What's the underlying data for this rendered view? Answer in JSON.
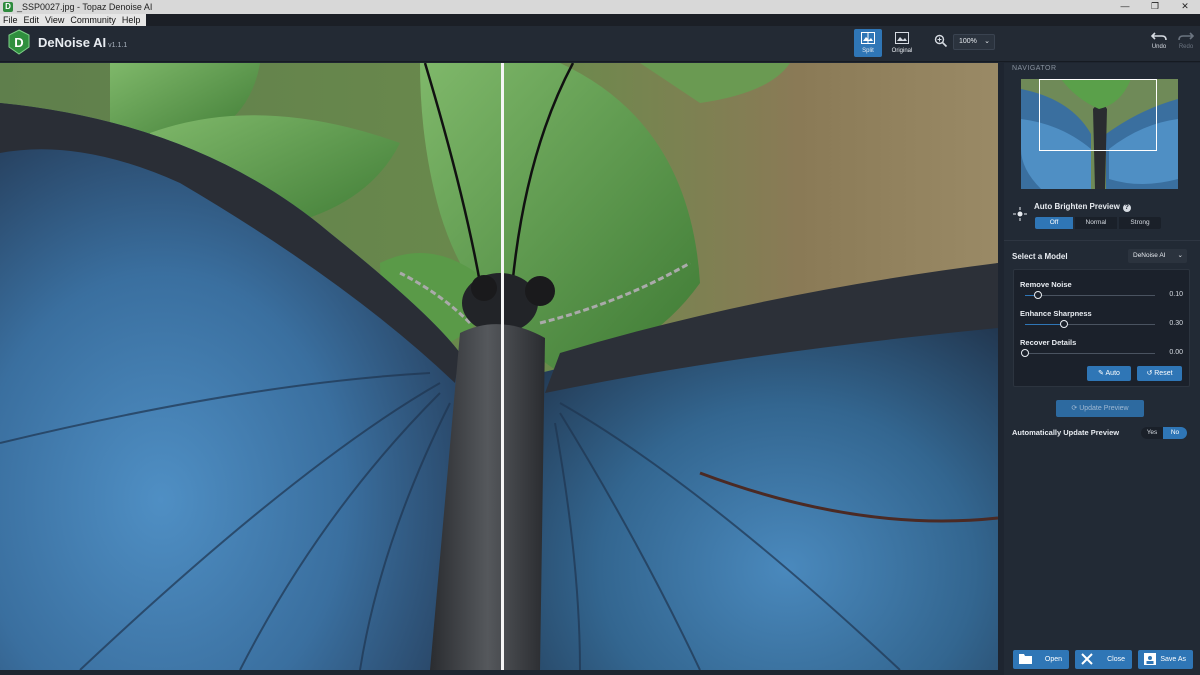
{
  "window": {
    "title": "_SSP0027.jpg - Topaz Denoise AI",
    "minimize": "—",
    "maximize": "❐",
    "close": "✕"
  },
  "menu": {
    "items": [
      {
        "label": "File"
      },
      {
        "label": "Edit"
      },
      {
        "label": "View"
      },
      {
        "label": "Community"
      },
      {
        "label": "Help"
      }
    ]
  },
  "header": {
    "app_name": "DeNoise AI",
    "version": "v1.1.1",
    "split_label": "Split",
    "original_label": "Original",
    "zoom_value": "100%",
    "undo_label": "Undo",
    "redo_label": "Redo"
  },
  "navigator": {
    "title": "NAVIGATOR"
  },
  "auto_brighten": {
    "title": "Auto Brighten Preview",
    "help": "?",
    "options": [
      "Off",
      "Normal",
      "Strong"
    ],
    "selected": "Off"
  },
  "model": {
    "label": "Select a Model",
    "selected": "DeNoise AI"
  },
  "sliders": [
    {
      "label": "Remove Noise",
      "value": "0.10",
      "fraction": 0.1
    },
    {
      "label": "Enhance Sharpness",
      "value": "0.30",
      "fraction": 0.3
    },
    {
      "label": "Recover Details",
      "value": "0.00",
      "fraction": 0.0
    }
  ],
  "buttons": {
    "auto": "Auto",
    "reset": "Reset",
    "update_preview": "Update Preview",
    "open": "Open",
    "close": "Close",
    "save_as": "Save As"
  },
  "auto_update": {
    "label": "Automatically Update Preview",
    "yes": "Yes",
    "no": "No",
    "selected": "No"
  },
  "colors": {
    "accent": "#2f76b6",
    "panel": "#222a35",
    "header": "#232a34"
  }
}
